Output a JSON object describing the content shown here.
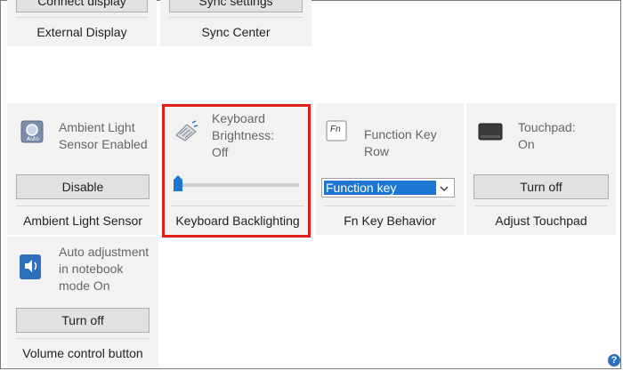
{
  "top_row": [
    {
      "button": "Connect display",
      "caption": "External Display"
    },
    {
      "button": "Sync settings",
      "caption": "Sync Center"
    }
  ],
  "tiles": {
    "ambient": {
      "status": "Ambient Light Sensor Enabled",
      "button": "Disable",
      "caption": "Ambient Light Sensor"
    },
    "keyboard": {
      "status": "Keyboard Brightness: Off",
      "caption": "Keyboard Backlighting",
      "brightness_level": 0
    },
    "fn": {
      "status": "Function Key Row",
      "select_value": "Function key",
      "caption": "Fn Key Behavior",
      "icon_text": "Fn"
    },
    "touchpad": {
      "status": "Touchpad: On",
      "button": "Turn off",
      "caption": "Adjust Touchpad"
    },
    "volume": {
      "status": "Auto adjustment in notebook mode On",
      "button": "Turn off",
      "caption": "Volume control button"
    }
  },
  "help": "?",
  "colors": {
    "highlight": "#e0201b",
    "select_highlight": "#1c76d2",
    "accent_icon": "#2e6fbd"
  }
}
